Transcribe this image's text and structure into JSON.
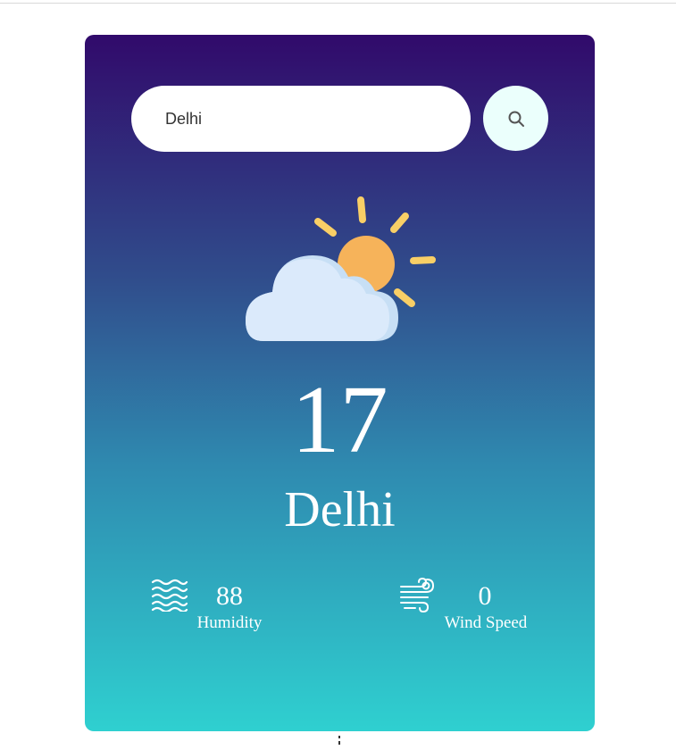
{
  "search": {
    "value": "Delhi",
    "button_icon": "search-icon"
  },
  "weather": {
    "icon": "partly-cloudy-icon",
    "temperature": "17",
    "city": "Delhi"
  },
  "stats": {
    "humidity": {
      "icon": "humidity-waves-icon",
      "value": "88",
      "label": "Humidity"
    },
    "wind": {
      "icon": "wind-icon",
      "value": "0",
      "label": "Wind Speed"
    }
  },
  "colors": {
    "gradient_top": "#310a6b",
    "gradient_bottom": "#2fd0d0",
    "search_button_bg": "#ebfffc",
    "sun": "#f6b35a",
    "sun_rays": "#f9cf66",
    "cloud": "#dbeafb"
  }
}
